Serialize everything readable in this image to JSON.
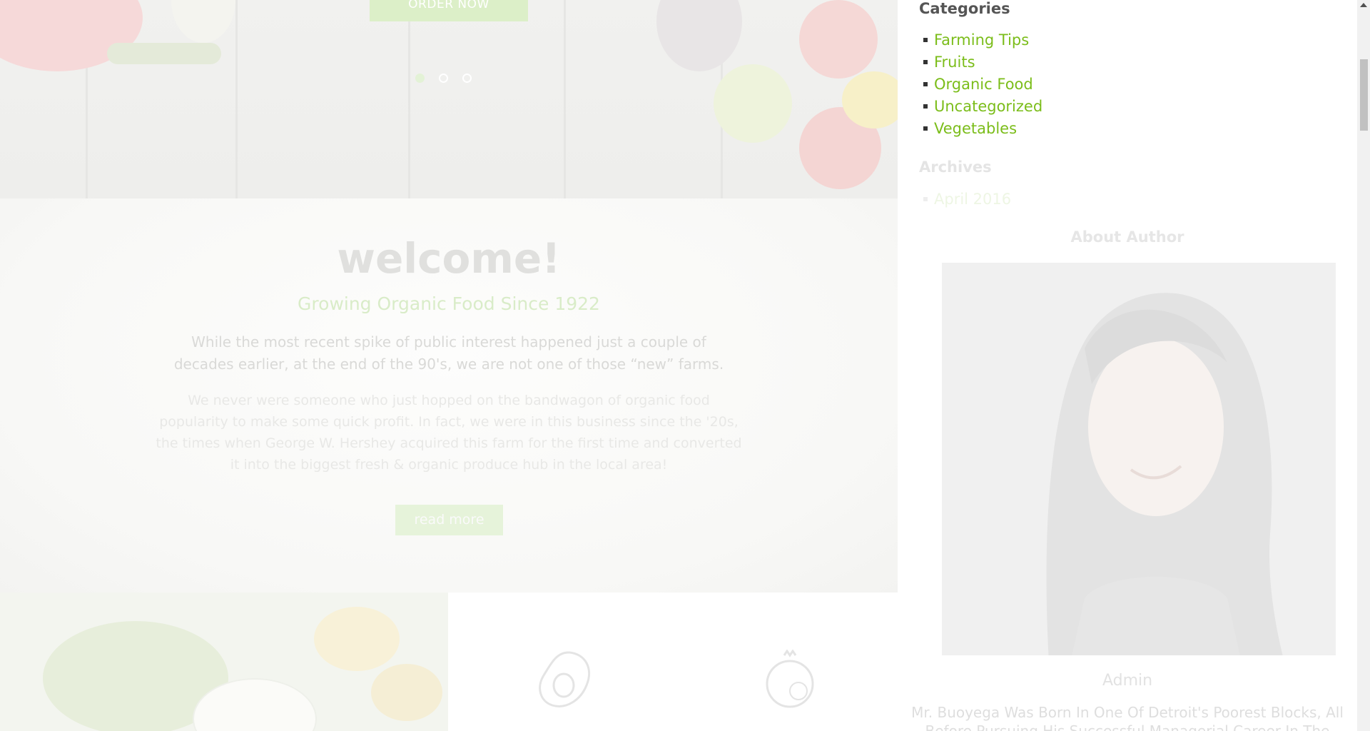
{
  "hero": {
    "order_button": "ORDER NOW",
    "slider_dot_count": 3,
    "active_slide": 1
  },
  "welcome": {
    "title": "welcome!",
    "subtitle": "Growing Organic Food Since 1922",
    "lead": "While the most recent spike of public interest happened just a couple of decades earlier, at the end of the 90's, we are not one of those “new” farms.",
    "body": "We never were someone who just hopped on the bandwagon of organic food popularity to make some quick profit. In fact, we were in this business since the '20s, the times when George W. Hershey acquired this farm for the first time and converted it into the biggest fresh & organic produce hub in the local area!",
    "read_more": "read more"
  },
  "features": {
    "icons": [
      "avocado-icon",
      "pomegranate-icon"
    ]
  },
  "sidebar": {
    "categories_title": "Categories",
    "categories": [
      {
        "label": "Farming Tips"
      },
      {
        "label": "Fruits"
      },
      {
        "label": "Organic Food"
      },
      {
        "label": "Uncategorized"
      },
      {
        "label": "Vegetables"
      }
    ],
    "archives_title": "Archives",
    "archives": [
      {
        "label": "April 2016"
      }
    ],
    "author_title": "About Author",
    "author_name": "Admin",
    "author_bio": "Mr. Buoyega Was Born In One Of Detroit's Poorest Blocks, All Before Pursuing His Successful Managerial Career In The"
  },
  "colors": {
    "accent_green": "#7bbd1a",
    "sidebar_heading": "#555555",
    "faded_overlay": "#ffffff"
  }
}
